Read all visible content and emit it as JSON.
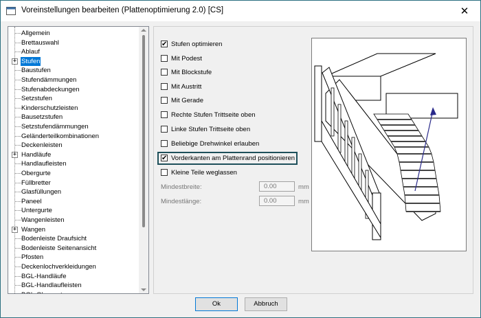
{
  "window": {
    "title": "Voreinstellungen bearbeiten (Plattenoptimierung 2.0) [CS]",
    "close": "✕"
  },
  "tree": {
    "items": [
      {
        "label": "Allgemein",
        "expandable": false,
        "selected": false
      },
      {
        "label": "Brettauswahl",
        "expandable": false,
        "selected": false
      },
      {
        "label": "Ablauf",
        "expandable": false,
        "selected": false
      },
      {
        "label": "Stufen",
        "expandable": true,
        "selected": true
      },
      {
        "label": "Baustufen",
        "expandable": false,
        "selected": false
      },
      {
        "label": "Stufendämmungen",
        "expandable": false,
        "selected": false
      },
      {
        "label": "Stufenabdeckungen",
        "expandable": false,
        "selected": false
      },
      {
        "label": "Setzstufen",
        "expandable": false,
        "selected": false
      },
      {
        "label": "Kinderschutzleisten",
        "expandable": false,
        "selected": false
      },
      {
        "label": "Bausetzstufen",
        "expandable": false,
        "selected": false
      },
      {
        "label": "Setzstufendämmungen",
        "expandable": false,
        "selected": false
      },
      {
        "label": "Geländerteilkombinationen",
        "expandable": false,
        "selected": false
      },
      {
        "label": "Deckenleisten",
        "expandable": false,
        "selected": false
      },
      {
        "label": "Handläufe",
        "expandable": true,
        "selected": false
      },
      {
        "label": "Handlaufleisten",
        "expandable": false,
        "selected": false
      },
      {
        "label": "Obergurte",
        "expandable": false,
        "selected": false
      },
      {
        "label": "Füllbretter",
        "expandable": false,
        "selected": false
      },
      {
        "label": "Glasfüllungen",
        "expandable": false,
        "selected": false
      },
      {
        "label": "Paneel",
        "expandable": false,
        "selected": false
      },
      {
        "label": "Untergurte",
        "expandable": false,
        "selected": false
      },
      {
        "label": "Wangenleisten",
        "expandable": false,
        "selected": false
      },
      {
        "label": "Wangen",
        "expandable": true,
        "selected": false
      },
      {
        "label": "Bodenleiste Draufsicht",
        "expandable": false,
        "selected": false
      },
      {
        "label": "Bodenleiste Seitenansicht",
        "expandable": false,
        "selected": false
      },
      {
        "label": "Pfosten",
        "expandable": false,
        "selected": false
      },
      {
        "label": "Deckenlochverkleidungen",
        "expandable": false,
        "selected": false
      },
      {
        "label": "BGL-Handläufe",
        "expandable": false,
        "selected": false
      },
      {
        "label": "BGL-Handlaufleisten",
        "expandable": false,
        "selected": false
      },
      {
        "label": "BGL-Obergurte",
        "expandable": false,
        "selected": false
      }
    ]
  },
  "options": [
    {
      "label": "Stufen optimieren",
      "checked": true
    },
    {
      "label": "Mit Podest",
      "checked": false
    },
    {
      "label": "Mit Blockstufe",
      "checked": false
    },
    {
      "label": "Mit Austritt",
      "checked": false
    },
    {
      "label": "Mit Gerade",
      "checked": false
    },
    {
      "label": "Rechte Stufen Trittseite oben",
      "checked": false
    },
    {
      "label": "Linke  Stufen Trittseite oben",
      "checked": false
    },
    {
      "label": "Beliebige Drehwinkel erlauben",
      "checked": false
    },
    {
      "label": "Vorderkanten am Plattenrand positionieren",
      "checked": true
    },
    {
      "label": "Kleine Teile weglassen",
      "checked": false
    }
  ],
  "fields": {
    "min_width_label": "Mindestbreite:",
    "min_width_value": "0.00",
    "min_length_label": "Mindestlänge:",
    "min_length_value": "0.00",
    "unit": "mm"
  },
  "buttons": {
    "ok": "Ok",
    "cancel": "Abbruch"
  },
  "colors": {
    "selection": "#0078d7",
    "highlight_border": "#1d4f5a",
    "arrow": "#2a2a8a"
  }
}
